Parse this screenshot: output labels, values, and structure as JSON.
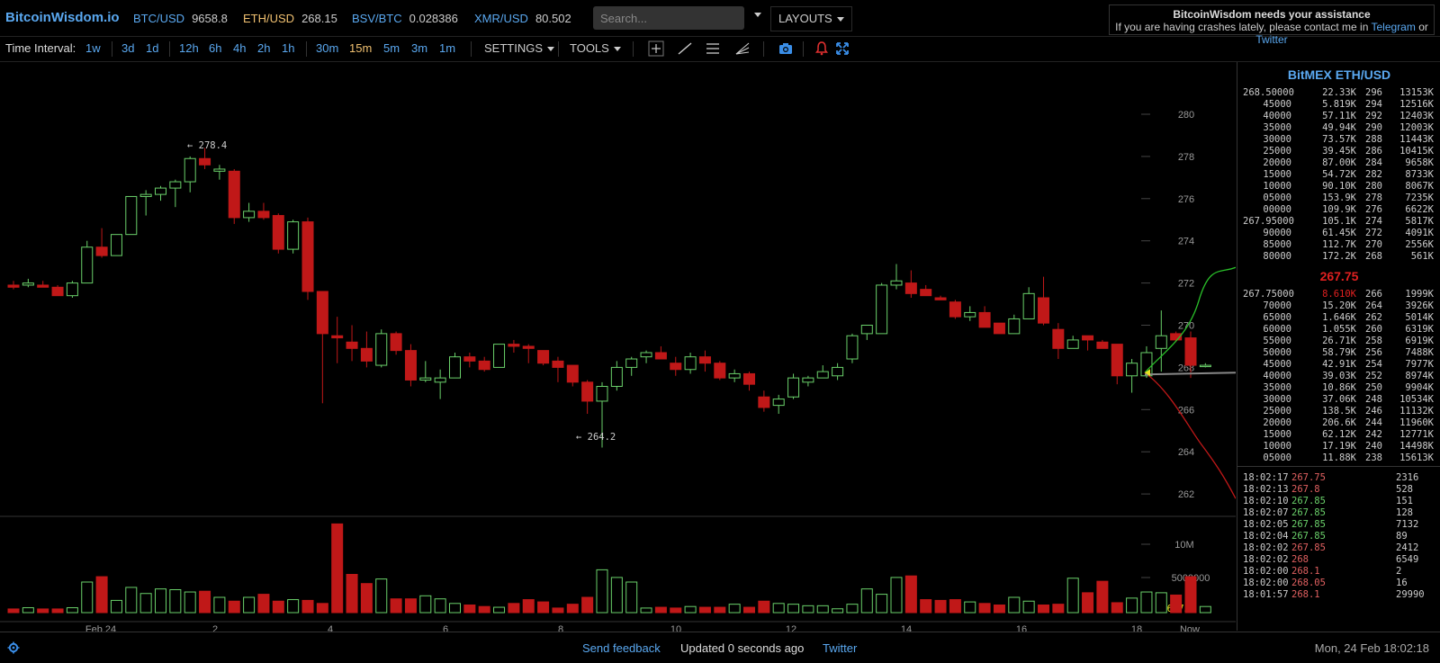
{
  "app": {
    "logo": "BitcoinWisdom.io"
  },
  "tickers": [
    {
      "pair": "BTC/USD",
      "value": "9658.8"
    },
    {
      "pair": "ETH/USD",
      "value": "268.15"
    },
    {
      "pair": "BSV/BTC",
      "value": "0.028386"
    },
    {
      "pair": "XMR/USD",
      "value": "80.502"
    }
  ],
  "search": {
    "placeholder": "Search..."
  },
  "layouts_label": "LAYOUTS",
  "notice": {
    "title": "BitcoinWisdom needs your assistance",
    "text": "If you are having crashes lately, please contact me in",
    "link1": "Telegram",
    "or": "or",
    "link2": "Twitter"
  },
  "toolbar": {
    "time_interval_label": "Time Interval:",
    "intervals": [
      "1w",
      "3d",
      "1d",
      "12h",
      "6h",
      "4h",
      "2h",
      "1h",
      "30m",
      "15m",
      "5m",
      "3m",
      "1m"
    ],
    "active_interval": "15m",
    "settings_label": "SETTINGS",
    "tools_label": "TOOLS"
  },
  "chart_data": {
    "type": "candlestick",
    "price_ticks": [
      "280",
      "278",
      "276",
      "274",
      "272",
      "270",
      "268",
      "266",
      "264",
      "262"
    ],
    "volume_ticks": [
      "10M",
      "5000000"
    ],
    "volume_last": "406675",
    "x_ticks": [
      "Feb 24",
      "2",
      "4",
      "6",
      "8",
      "10",
      "12",
      "14",
      "16",
      "18",
      "Now"
    ],
    "annotations": {
      "high": "← 278.4",
      "low": "← 264.2"
    },
    "last_price": 267.75,
    "candles": [
      [
        271.9,
        272.1,
        271.7,
        271.8
      ],
      [
        271.9,
        272.2,
        271.8,
        272.0
      ],
      [
        271.9,
        272.1,
        271.8,
        271.8
      ],
      [
        271.8,
        271.9,
        271.4,
        271.4
      ],
      [
        271.4,
        272.1,
        271.3,
        272.0
      ],
      [
        272.0,
        274.0,
        272.0,
        273.7
      ],
      [
        273.7,
        274.6,
        273.2,
        273.3
      ],
      [
        273.3,
        274.3,
        273.3,
        274.3
      ],
      [
        274.3,
        276.0,
        274.3,
        276.1
      ],
      [
        276.1,
        276.4,
        275.2,
        276.2
      ],
      [
        276.2,
        276.6,
        275.9,
        276.5
      ],
      [
        276.5,
        276.9,
        275.6,
        276.8
      ],
      [
        276.8,
        278.0,
        276.3,
        277.9
      ],
      [
        277.9,
        278.4,
        277.4,
        277.6
      ],
      [
        277.3,
        277.6,
        276.9,
        277.4
      ],
      [
        277.3,
        277.4,
        274.8,
        275.1
      ],
      [
        275.1,
        275.8,
        274.9,
        275.4
      ],
      [
        275.4,
        275.8,
        275.0,
        275.1
      ],
      [
        275.2,
        275.3,
        273.4,
        273.6
      ],
      [
        273.6,
        275.0,
        273.4,
        274.9
      ],
      [
        274.9,
        275.1,
        271.2,
        271.6
      ],
      [
        271.6,
        271.6,
        266.3,
        269.6
      ],
      [
        269.5,
        270.4,
        268.2,
        269.4
      ],
      [
        269.2,
        270.0,
        268.3,
        268.9
      ],
      [
        268.9,
        269.7,
        268.0,
        268.3
      ],
      [
        268.1,
        269.8,
        268.0,
        269.6
      ],
      [
        269.6,
        269.7,
        268.6,
        268.8
      ],
      [
        268.8,
        269.1,
        267.1,
        267.4
      ],
      [
        267.4,
        268.3,
        267.3,
        267.5
      ],
      [
        267.3,
        267.9,
        266.5,
        267.5
      ],
      [
        267.5,
        268.7,
        267.5,
        268.5
      ],
      [
        268.5,
        268.7,
        268.0,
        268.3
      ],
      [
        268.3,
        268.5,
        267.8,
        267.9
      ],
      [
        268.0,
        269.1,
        268.0,
        269.1
      ],
      [
        269.1,
        269.3,
        268.7,
        269.0
      ],
      [
        269.0,
        269.1,
        268.2,
        268.9
      ],
      [
        268.8,
        268.8,
        268.1,
        268.2
      ],
      [
        268.3,
        268.5,
        267.3,
        268.0
      ],
      [
        268.1,
        268.1,
        267.1,
        267.3
      ],
      [
        267.3,
        267.4,
        265.8,
        266.4
      ],
      [
        266.4,
        267.3,
        264.2,
        267.1
      ],
      [
        267.1,
        268.3,
        266.9,
        268.0
      ],
      [
        268.0,
        268.5,
        267.6,
        268.4
      ],
      [
        268.5,
        268.8,
        268.2,
        268.7
      ],
      [
        268.7,
        269.0,
        268.4,
        268.4
      ],
      [
        268.2,
        268.5,
        267.6,
        267.9
      ],
      [
        267.9,
        268.7,
        267.7,
        268.5
      ],
      [
        268.5,
        268.8,
        267.8,
        268.2
      ],
      [
        268.2,
        268.3,
        267.4,
        267.5
      ],
      [
        267.5,
        267.9,
        267.3,
        267.7
      ],
      [
        267.7,
        267.8,
        266.9,
        267.2
      ],
      [
        266.6,
        266.9,
        265.9,
        266.1
      ],
      [
        266.2,
        266.7,
        265.8,
        266.5
      ],
      [
        266.6,
        267.7,
        266.5,
        267.5
      ],
      [
        267.3,
        267.6,
        267.1,
        267.5
      ],
      [
        267.5,
        268.1,
        267.5,
        267.8
      ],
      [
        267.6,
        268.2,
        267.4,
        268.0
      ],
      [
        268.4,
        269.6,
        268.2,
        269.5
      ],
      [
        269.6,
        270.0,
        269.3,
        270.0
      ],
      [
        269.6,
        272.0,
        269.6,
        271.9
      ],
      [
        271.9,
        272.9,
        271.7,
        272.1
      ],
      [
        272.0,
        272.6,
        271.3,
        271.5
      ],
      [
        271.7,
        271.9,
        271.4,
        271.4
      ],
      [
        271.3,
        271.4,
        271.2,
        271.2
      ],
      [
        271.1,
        271.2,
        270.3,
        270.4
      ],
      [
        270.4,
        270.9,
        270.2,
        270.6
      ],
      [
        270.6,
        270.9,
        269.9,
        269.9
      ],
      [
        270.1,
        270.1,
        269.6,
        269.6
      ],
      [
        269.6,
        270.5,
        269.6,
        270.3
      ],
      [
        270.3,
        271.8,
        270.3,
        271.5
      ],
      [
        271.3,
        272.3,
        270.0,
        270.1
      ],
      [
        269.8,
        270.1,
        268.4,
        268.9
      ],
      [
        268.9,
        269.5,
        268.9,
        269.3
      ],
      [
        269.5,
        269.5,
        268.8,
        269.3
      ],
      [
        269.2,
        269.3,
        268.9,
        268.9
      ],
      [
        269.1,
        269.1,
        267.2,
        267.6
      ],
      [
        267.6,
        268.4,
        266.8,
        268.2
      ],
      [
        267.6,
        269.0,
        267.5,
        268.7
      ],
      [
        268.9,
        270.7,
        267.8,
        269.5
      ],
      [
        269.6,
        269.7,
        269.2,
        269.3
      ],
      [
        269.4,
        269.7,
        267.5,
        268.1
      ],
      [
        268.1,
        268.2,
        268.0,
        268.1
      ]
    ],
    "volumes": [
      0.24,
      0.32,
      0.24,
      0.24,
      0.32,
      2.0,
      2.35,
      0.8,
      1.65,
      1.25,
      1.55,
      1.5,
      1.35,
      1.4,
      1.0,
      0.75,
      1.0,
      1.2,
      0.75,
      0.85,
      0.8,
      0.6,
      5.8,
      2.5,
      1.9,
      2.2,
      0.9,
      0.9,
      1.1,
      0.9,
      0.6,
      0.5,
      0.4,
      0.35,
      0.6,
      0.85,
      0.7,
      0.3,
      0.55,
      1.0,
      2.8,
      2.3,
      2.0,
      0.3,
      0.35,
      0.3,
      0.4,
      0.35,
      0.35,
      0.55,
      0.35,
      0.75,
      0.6,
      0.55,
      0.45,
      0.45,
      0.25,
      0.55,
      1.55,
      1.2,
      2.3,
      2.4,
      0.85,
      0.8,
      0.85,
      0.7,
      0.6,
      0.5,
      1.0,
      0.75,
      0.5,
      0.55,
      2.25,
      1.3,
      2.05,
      0.65,
      0.95,
      1.35,
      1.3,
      1.15,
      2.35,
      0.4
    ]
  },
  "orderbook": {
    "title": "BitMEX ETH/USD",
    "asks": [
      [
        "268.50000",
        "22.33K",
        "296",
        "13153K"
      ],
      [
        "45000",
        "5.819K",
        "294",
        "12516K"
      ],
      [
        "40000",
        "57.11K",
        "292",
        "12403K"
      ],
      [
        "35000",
        "49.94K",
        "290",
        "12003K"
      ],
      [
        "30000",
        "73.57K",
        "288",
        "11443K"
      ],
      [
        "25000",
        "39.45K",
        "286",
        "10415K"
      ],
      [
        "20000",
        "87.00K",
        "284",
        "9658K"
      ],
      [
        "15000",
        "54.72K",
        "282",
        "8733K"
      ],
      [
        "10000",
        "90.10K",
        "280",
        "8067K"
      ],
      [
        "05000",
        "153.9K",
        "278",
        "7235K"
      ],
      [
        "00000",
        "109.9K",
        "276",
        "6622K"
      ],
      [
        "267.95000",
        "105.1K",
        "274",
        "5817K"
      ],
      [
        "90000",
        "61.45K",
        "272",
        "4091K"
      ],
      [
        "85000",
        "112.7K",
        "270",
        "2556K"
      ],
      [
        "80000",
        "172.2K",
        "268",
        "561K"
      ]
    ],
    "last": "267.75",
    "bids": [
      [
        "267.75000",
        "8.610K",
        "266",
        "1999K"
      ],
      [
        "70000",
        "15.20K",
        "264",
        "3926K"
      ],
      [
        "65000",
        "1.646K",
        "262",
        "5014K"
      ],
      [
        "60000",
        "1.055K",
        "260",
        "6319K"
      ],
      [
        "55000",
        "26.71K",
        "258",
        "6919K"
      ],
      [
        "50000",
        "58.79K",
        "256",
        "7488K"
      ],
      [
        "45000",
        "42.91K",
        "254",
        "7977K"
      ],
      [
        "40000",
        "39.03K",
        "252",
        "8974K"
      ],
      [
        "35000",
        "10.86K",
        "250",
        "9904K"
      ],
      [
        "30000",
        "37.06K",
        "248",
        "10534K"
      ],
      [
        "25000",
        "138.5K",
        "246",
        "11132K"
      ],
      [
        "20000",
        "206.6K",
        "244",
        "11960K"
      ],
      [
        "15000",
        "62.12K",
        "242",
        "12771K"
      ],
      [
        "10000",
        "17.19K",
        "240",
        "14498K"
      ],
      [
        "05000",
        "11.88K",
        "238",
        "15613K"
      ]
    ]
  },
  "trades": [
    {
      "time": "18:02:17",
      "price": "267.75",
      "qty": "2316",
      "side": "dn"
    },
    {
      "time": "18:02:13",
      "price": "267.8",
      "qty": "528",
      "side": "dn"
    },
    {
      "time": "18:02:10",
      "price": "267.85",
      "qty": "151",
      "side": "up"
    },
    {
      "time": "18:02:07",
      "price": "267.85",
      "qty": "128",
      "side": "up"
    },
    {
      "time": "18:02:05",
      "price": "267.85",
      "qty": "7132",
      "side": "up"
    },
    {
      "time": "18:02:04",
      "price": "267.85",
      "qty": "89",
      "side": "up"
    },
    {
      "time": "18:02:02",
      "price": "267.85",
      "qty": "2412",
      "side": "dn"
    },
    {
      "time": "18:02:02",
      "price": "268",
      "qty": "6549",
      "side": "dn"
    },
    {
      "time": "18:02:00",
      "price": "268.1",
      "qty": "2",
      "side": "dn"
    },
    {
      "time": "18:02:00",
      "price": "268.05",
      "qty": "16",
      "side": "dn"
    },
    {
      "time": "18:01:57",
      "price": "268.1",
      "qty": "29990",
      "side": "dn"
    }
  ],
  "status": {
    "feedback": "Send feedback",
    "updated": "Updated 0 seconds ago",
    "twitter": "Twitter",
    "clock": "Mon, 24 Feb 18:02:18"
  },
  "colors": {
    "accent": "#5aa8f0",
    "up": "#6ad06a",
    "down": "#c01818",
    "active": "#f0c070"
  }
}
